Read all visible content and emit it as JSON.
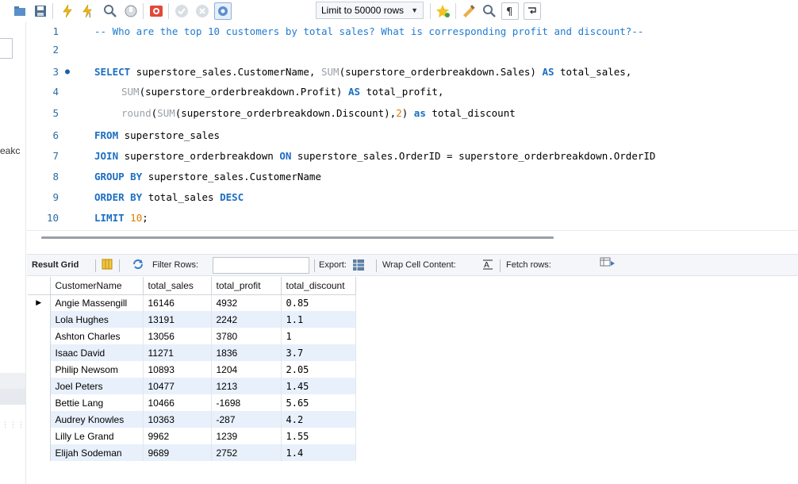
{
  "toolbar": {
    "limit_select": "Limit to 50000 rows",
    "icons": [
      "folder-icon",
      "save-icon",
      "execute-icon",
      "execute-cursor-icon",
      "explain-icon",
      "stop-icon",
      "toggle-error-icon",
      "commit-icon",
      "rollback-icon",
      "autocommit-icon",
      "bookmark-icon",
      "beautify-icon",
      "find-icon",
      "invisible-chars-icon",
      "wrap-icon"
    ]
  },
  "sidebar": {
    "partial_text": "eakc"
  },
  "editor": {
    "lines": [
      {
        "num": "1"
      },
      {
        "num": "2"
      },
      {
        "num": "3",
        "marker": "●"
      },
      {
        "num": "4"
      },
      {
        "num": "5"
      },
      {
        "num": "6"
      },
      {
        "num": "7"
      },
      {
        "num": "8"
      },
      {
        "num": "9"
      },
      {
        "num": "10"
      }
    ],
    "tokens": {
      "l1": "-- Who are the top 10 customers by total sales? What is corresponding profit and discount?--",
      "select": "SELECT",
      "l3a": " superstore_sales.CustomerName, ",
      "sum": "SUM",
      "l3b": "(superstore_orderbreakdown.Sales) ",
      "as_upper": "AS",
      "l3c": " total_sales,",
      "l4a": "(superstore_orderbreakdown.Profit) ",
      "l4b": " total_profit,",
      "round": "round",
      "l5a": "(",
      "l5b": "(superstore_orderbreakdown.Discount),",
      "two": "2",
      "l5c": ") ",
      "as_lower": "as",
      "l5d": " total_discount",
      "from": "FROM",
      "l6": " superstore_sales",
      "join": "JOIN",
      "l7a": " superstore_orderbreakdown ",
      "on": "ON",
      "l7b": " superstore_sales.OrderID = superstore_orderbreakdown.OrderID",
      "group_by": "GROUP BY",
      "l8": " superstore_sales.CustomerName",
      "order_by": "ORDER BY",
      "l9a": " total_sales ",
      "desc": "DESC",
      "limit": "LIMIT",
      "ten": "10",
      "semi": ";"
    }
  },
  "results": {
    "tab_label": "Result Grid",
    "filter_label": "Filter Rows:",
    "export_label": "Export:",
    "wrap_label": "Wrap Cell Content:",
    "fetch_label": "Fetch rows:",
    "columns": [
      "CustomerName",
      "total_sales",
      "total_profit",
      "total_discount"
    ],
    "rows": [
      [
        "Angie Massengill",
        "16146",
        "4932",
        "0.85"
      ],
      [
        "Lola Hughes",
        "13191",
        "2242",
        "1.1"
      ],
      [
        "Ashton Charles",
        "13056",
        "3780",
        "1"
      ],
      [
        "Isaac David",
        "11271",
        "1836",
        "3.7"
      ],
      [
        "Philip Newsom",
        "10893",
        "1204",
        "2.05"
      ],
      [
        "Joel Peters",
        "10477",
        "1213",
        "1.45"
      ],
      [
        "Bettie Lang",
        "10466",
        "-1698",
        "5.65"
      ],
      [
        "Audrey Knowles",
        "10363",
        "-287",
        "4.2"
      ],
      [
        "Lilly Le Grand",
        "9962",
        "1239",
        "1.55"
      ],
      [
        "Elijah Sodeman",
        "9689",
        "2752",
        "1.4"
      ]
    ],
    "current_row_marker": "▶"
  }
}
